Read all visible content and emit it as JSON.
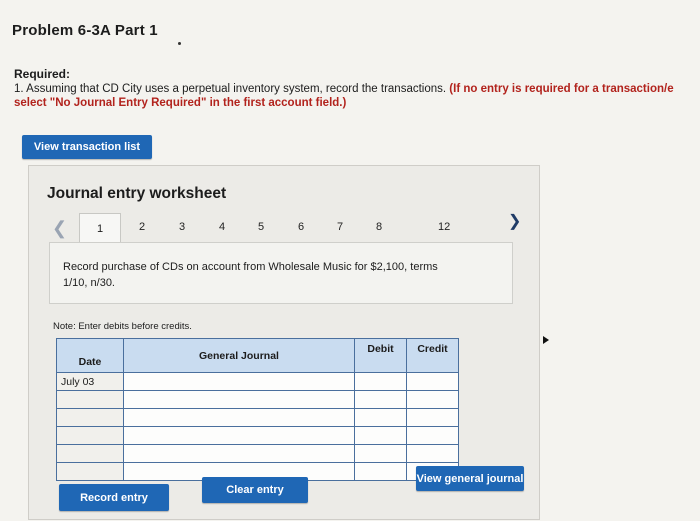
{
  "header": {
    "title": "Problem 6-3A Part 1",
    "required_label": "Required:",
    "required_text": "1. Assuming that CD City uses a perpetual inventory system, record the transactions.",
    "required_note_line1": "(If no entry is required for a transaction/e",
    "required_note_line2": "select \"No Journal Entry Required\" in the first account field.)"
  },
  "buttons": {
    "view_transaction_list": "View transaction list",
    "record_entry": "Record entry",
    "clear_entry": "Clear entry",
    "view_general_journal": "View general journal"
  },
  "worksheet": {
    "title": "Journal entry worksheet",
    "tabs": [
      "1",
      "2",
      "3",
      "4",
      "5",
      "6",
      "7",
      "8",
      "12"
    ],
    "active_tab": "1",
    "description": "Record purchase of CDs on account from Wholesale Music for $2,100, terms 1/10, n/30.",
    "note": "Note: Enter debits before credits.",
    "table": {
      "headers": {
        "date": "Date",
        "general_journal": "General Journal",
        "debit": "Debit",
        "credit": "Credit"
      },
      "rows": [
        {
          "date": "July 03",
          "account": "",
          "debit": "",
          "credit": ""
        },
        {
          "date": "",
          "account": "",
          "debit": "",
          "credit": ""
        },
        {
          "date": "",
          "account": "",
          "debit": "",
          "credit": ""
        },
        {
          "date": "",
          "account": "",
          "debit": "",
          "credit": ""
        },
        {
          "date": "",
          "account": "",
          "debit": "",
          "credit": ""
        },
        {
          "date": "",
          "account": "",
          "debit": "",
          "credit": ""
        }
      ]
    }
  },
  "colors": {
    "button_blue": "#1f67b5",
    "note_red": "#b2231d",
    "table_header": "#c9dcf0"
  }
}
